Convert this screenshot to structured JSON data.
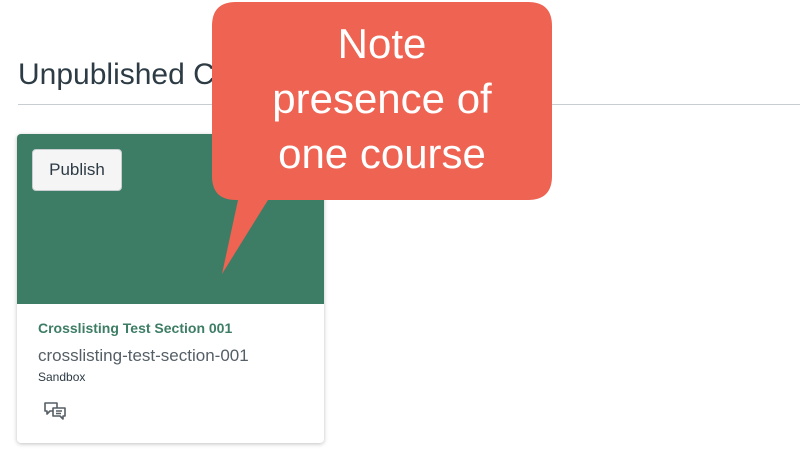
{
  "section": {
    "heading": "Unpublished Courses"
  },
  "course_card": {
    "publish_label": "Publish",
    "title": "Crosslisting Test Section 001",
    "code": "crosslisting-test-section-001",
    "term": "Sandbox",
    "hero_color": "#3d7d65",
    "title_color": "#3d7d65",
    "action_icon": "discussions-icon"
  },
  "callout": {
    "lines": [
      "Note",
      "presence of",
      "one course"
    ],
    "color": "#ee6352"
  }
}
